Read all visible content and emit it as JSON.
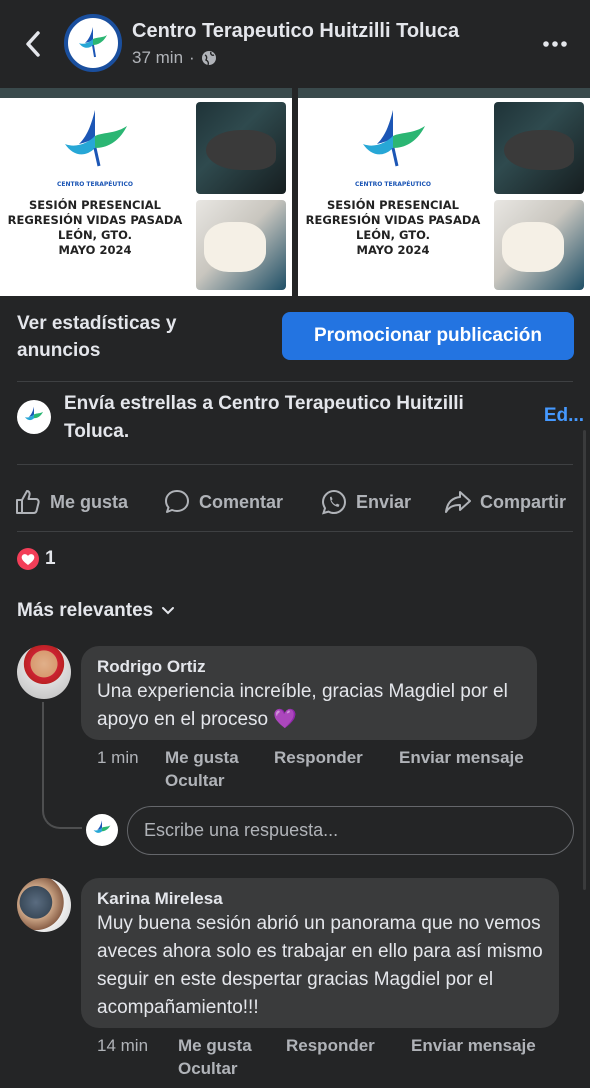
{
  "header": {
    "page_name": "Centro Terapeutico Huitzilli Toluca",
    "time": "37 min",
    "separator": "·"
  },
  "images": [
    {
      "logo_caption": "CENTRO TERAPÉUTICO",
      "lines": [
        "SESIÓN PRESENCIAL",
        "REGRESIÓN VIDAS PASADA",
        "LEÓN, GTO.",
        "MAYO 2024"
      ]
    },
    {
      "logo_caption": "CENTRO TERAPÉUTICO",
      "lines": [
        "SESIÓN PRESENCIAL",
        "REGRESIÓN VIDAS PASADA",
        "LEÓN, GTO.",
        "MAYO 2024"
      ]
    }
  ],
  "promo": {
    "stats_label": "Ver estadísticas y anuncios",
    "button_label": "Promocionar publicación"
  },
  "stars": {
    "text": "Envía estrellas a Centro Terapeutico Huitzilli Toluca.",
    "edit_label": "Ed..."
  },
  "actions": {
    "like": "Me gusta",
    "comment": "Comentar",
    "send": "Enviar",
    "share": "Compartir"
  },
  "reactions": {
    "count": "1"
  },
  "sort_label": "Más relevantes",
  "comments": [
    {
      "name": "Rodrigo Ortiz",
      "text": "Una experiencia increíble, gracias Magdiel por el apoyo en el proceso 💜",
      "time": "1 min",
      "like": "Me gusta",
      "reply": "Responder",
      "message": "Enviar mensaje",
      "hide": "Ocultar"
    },
    {
      "name": "Karina Mirelesa",
      "text": "Muy buena sesión abrió un panorama que no vemos aveces ahora solo es trabajar en ello para así mismo seguir en este despertar gracias Magdiel por el acompañamiento!!!",
      "time": "14 min",
      "like": "Me gusta",
      "reply": "Responder",
      "message": "Enviar mensaje",
      "hide": "Ocultar"
    }
  ],
  "reply": {
    "placeholder": "Escribe una respuesta..."
  },
  "colors": {
    "background": "#242526",
    "bubble": "#3a3b3c",
    "accent": "#2374e1",
    "link": "#4599ff",
    "heart": "#f33e58"
  }
}
